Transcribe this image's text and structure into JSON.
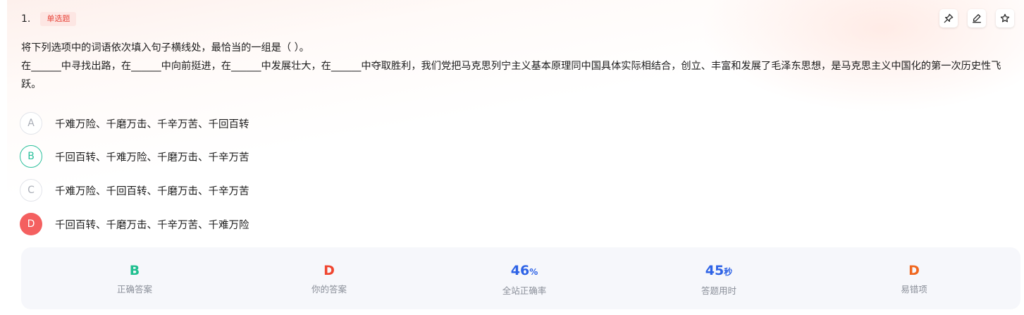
{
  "question": {
    "number": "1.",
    "type_badge": "单选题",
    "prompt": "将下列选项中的词语依次填入句子横线处，最恰当的一组是（ ）。",
    "body": "在______中寻找出路，在______中向前挺进，在______中发展壮大，在______中夺取胜利，我们党把马克思列宁主义基本原理同中国具体实际相结合，创立、丰富和发展了毛泽东思想，是马克思主义中国化的第一次历史性飞跃。"
  },
  "toolbar": {
    "icons": [
      "pin-icon",
      "edit-icon",
      "star-icon"
    ]
  },
  "options": [
    {
      "letter": "A",
      "text": "千难万险、千磨万击、千辛万苦、千回百转",
      "state": "normal"
    },
    {
      "letter": "B",
      "text": "千回百转、千难万险、千磨万击、千辛万苦",
      "state": "correct"
    },
    {
      "letter": "C",
      "text": "千难万险、千回百转、千磨万击、千辛万苦",
      "state": "normal"
    },
    {
      "letter": "D",
      "text": "千回百转、千磨万击、千辛万苦、千难万险",
      "state": "wrong"
    }
  ],
  "stats": {
    "correct_answer": {
      "value": "B",
      "label": "正确答案",
      "color": "#1fbf8f"
    },
    "your_answer": {
      "value": "D",
      "label": "你的答案",
      "color": "#f0452f"
    },
    "accuracy": {
      "value": "46",
      "unit": "%",
      "label": "全站正确率",
      "color": "#2e63e6"
    },
    "time_used": {
      "value": "45",
      "unit": "秒",
      "label": "答题用时",
      "color": "#2e63e6"
    },
    "error_prone": {
      "value": "D",
      "label": "易错项",
      "color": "#f0671f"
    }
  },
  "colors": {
    "correct": "#2cc09c",
    "wrong": "#f46060",
    "badge": "#e8473c"
  }
}
